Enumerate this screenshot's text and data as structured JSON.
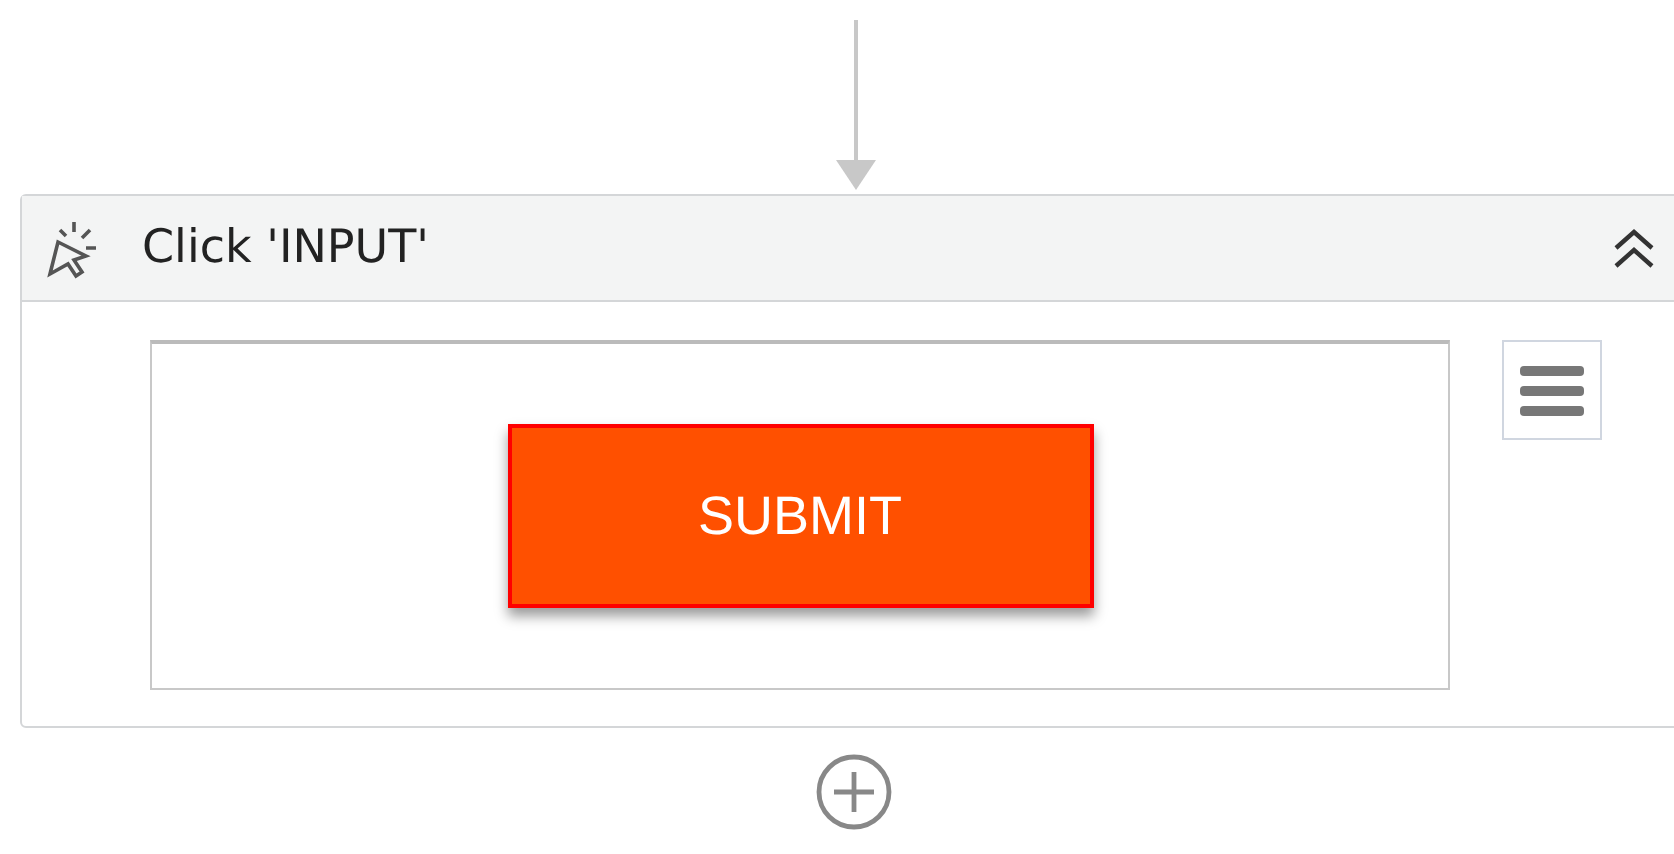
{
  "activity": {
    "title": "Click 'INPUT'",
    "expanded": true,
    "preview": {
      "button_label": "SUBMIT"
    }
  }
}
